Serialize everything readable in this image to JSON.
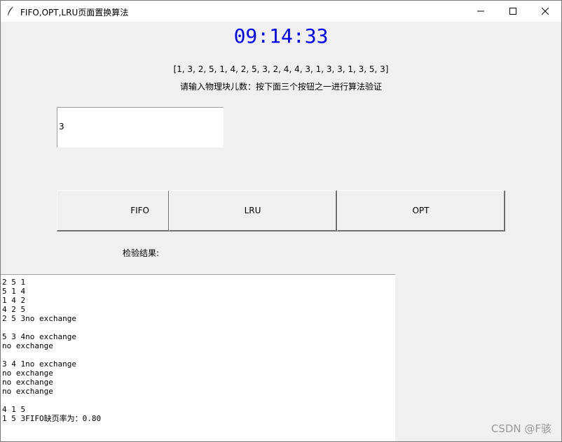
{
  "window": {
    "title": "FIFO,OPT,LRU页面置换算法",
    "controls": {
      "minimize": "minimize",
      "maximize": "maximize",
      "close": "close"
    }
  },
  "clock": "09:14:33",
  "sequence": "[1, 3, 2, 5, 1, 4, 2, 5, 3, 2, 4, 4, 3, 1, 3, 3, 1, 3, 5, 3]",
  "prompt": "请输入物理块儿数：按下面三个按钮之一进行算法验证",
  "input": {
    "value": "3"
  },
  "buttons": {
    "fifo": "FIFO",
    "lru": "LRU",
    "opt": "OPT"
  },
  "result_label": "检验结果:",
  "output_lines": [
    "2 5 1",
    "5 1 4",
    "1 4 2",
    "4 2 5",
    "2 5 3no exchange",
    "",
    "5 3 4no exchange",
    "no exchange",
    "",
    "3 4 1no exchange",
    "no exchange",
    "no exchange",
    "no exchange",
    "",
    "4 1 5",
    "1 5 3FIFO缺页率为：0.80"
  ],
  "watermark": "CSDN @F骇",
  "colors": {
    "clock": "#0000ff",
    "background": "#f0f0f0"
  },
  "icons": {
    "app": "feather-icon"
  }
}
